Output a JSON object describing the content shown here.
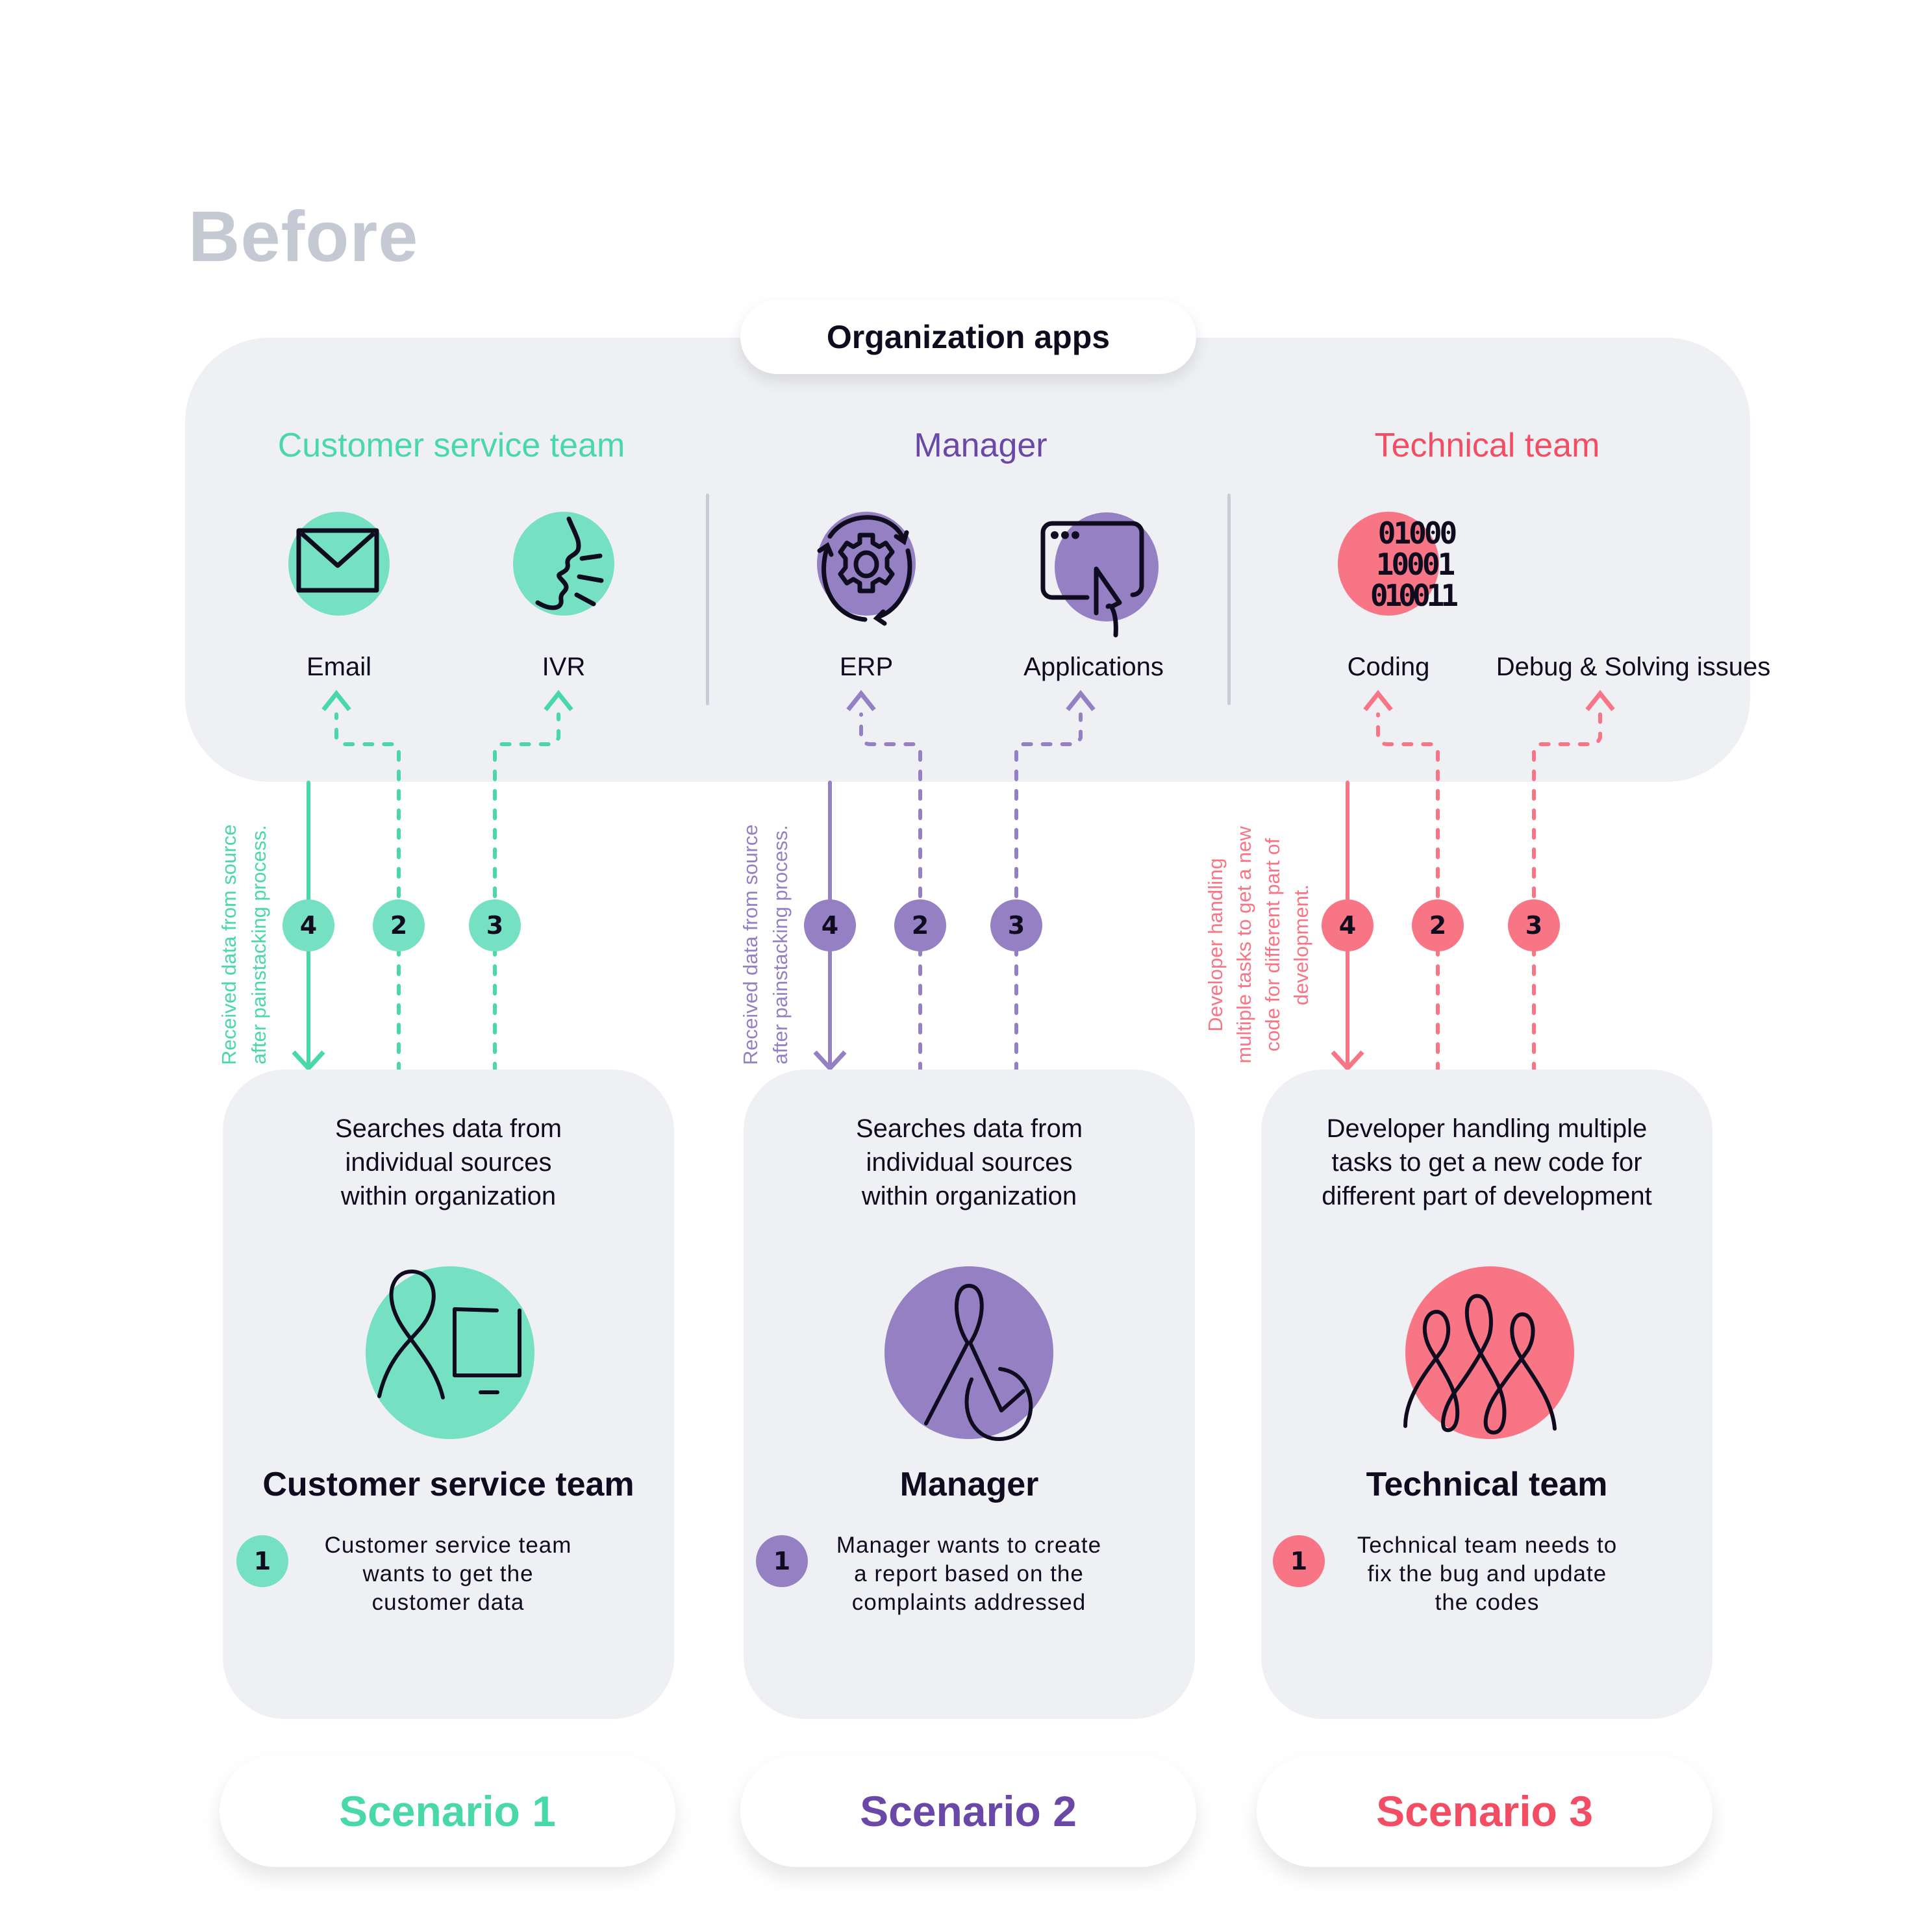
{
  "page": {
    "title": "Before",
    "panel_label": "Organization apps"
  },
  "colors": {
    "green": "#76e0c2",
    "green_text": "#48d8aa",
    "purple": "#9580c4",
    "purple_text": "#6a48a8",
    "red": "#f87585",
    "red_text": "#f34d63",
    "ink": "#0f0c1f",
    "panel_bg": "#eff0f4",
    "title_gray": "#c5c9d3"
  },
  "groups": [
    {
      "title": "Customer service team",
      "apps": [
        {
          "label": "Email",
          "icon": "envelope-icon"
        },
        {
          "label": "IVR",
          "icon": "speaking-face-icon"
        }
      ]
    },
    {
      "title": "Manager",
      "apps": [
        {
          "label": "ERP",
          "icon": "gear-cycle-icon"
        },
        {
          "label": "Applications",
          "icon": "app-window-cursor-icon"
        }
      ]
    },
    {
      "title": "Technical team",
      "apps": [
        {
          "label": "Coding",
          "icon": "binary-code-icon"
        },
        {
          "label": "Debug & Solving issues",
          "icon": ""
        }
      ]
    }
  ],
  "flows": [
    {
      "side_note": [
        "Received data from source",
        "after painstacking process."
      ],
      "steps": [
        "4",
        "2",
        "3"
      ]
    },
    {
      "side_note": [
        "Received data from source",
        "after painstacking process."
      ],
      "steps": [
        "4",
        "2",
        "3"
      ]
    },
    {
      "side_note": [
        "Developer handling",
        "multiple tasks to get a new",
        "code for different part of",
        "development."
      ],
      "steps": [
        "4",
        "2",
        "3"
      ]
    }
  ],
  "scenarios": [
    {
      "description": [
        "Searches data from",
        "individual sources",
        "within organization"
      ],
      "icon": "person-computer-icon",
      "team": "Customer service team",
      "step_number": "1",
      "step_text": [
        "Customer service team",
        "wants to get the",
        "customer data"
      ],
      "label": "Scenario 1"
    },
    {
      "description": [
        "Searches data from",
        "individual sources",
        "within organization"
      ],
      "icon": "manager-check-icon",
      "team": "Manager",
      "step_number": "1",
      "step_text": [
        "Manager wants to create",
        "a report based on the",
        "complaints addressed"
      ],
      "label": "Scenario 2"
    },
    {
      "description": [
        "Developer handling multiple",
        "tasks to get a new code for",
        "different part of development"
      ],
      "icon": "team-loops-icon",
      "team": "Technical team",
      "step_number": "1",
      "step_text": [
        "Technical team needs to",
        "fix the bug and update",
        "the codes"
      ],
      "label": "Scenario 3"
    }
  ]
}
